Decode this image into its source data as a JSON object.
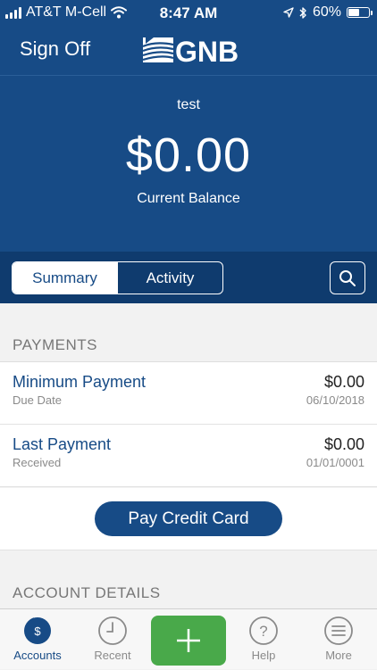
{
  "status_bar": {
    "carrier": "AT&T M-Cell",
    "time": "8:47 AM",
    "battery_percent": "60%",
    "battery_level": 0.6,
    "icons": [
      "signal-bars-icon",
      "wifi-icon",
      "location-arrow-icon",
      "bluetooth-icon",
      "battery-icon"
    ]
  },
  "nav": {
    "sign_off_label": "Sign Off",
    "logo_text": "GNB"
  },
  "hero": {
    "account_name": "test",
    "balance": "$0.00",
    "balance_label": "Current Balance"
  },
  "segments": {
    "items": [
      {
        "label": "Summary",
        "active": true
      },
      {
        "label": "Activity",
        "active": false
      }
    ],
    "search_icon": "search-icon"
  },
  "payments": {
    "header": "PAYMENTS",
    "rows": [
      {
        "title": "Minimum Payment",
        "subtitle": "Due Date",
        "amount": "$0.00",
        "date": "06/10/2018"
      },
      {
        "title": "Last Payment",
        "subtitle": "Received",
        "amount": "$0.00",
        "date": "01/01/0001"
      }
    ],
    "pay_button_label": "Pay Credit Card"
  },
  "account_details": {
    "header": "ACCOUNT DETAILS"
  },
  "tab_bar": {
    "items": [
      {
        "label": "Accounts",
        "icon": "dollar-circle-icon",
        "active": true
      },
      {
        "label": "Recent",
        "icon": "clock-icon",
        "active": false
      },
      {
        "label": "",
        "icon": "plus-icon",
        "active": false
      },
      {
        "label": "Help",
        "icon": "question-circle-icon",
        "active": false
      },
      {
        "label": "More",
        "icon": "menu-circle-icon",
        "active": false
      }
    ]
  },
  "colors": {
    "brand_blue": "#174b86",
    "dark_blue": "#0f3b6e",
    "action_green": "#49a94a"
  }
}
